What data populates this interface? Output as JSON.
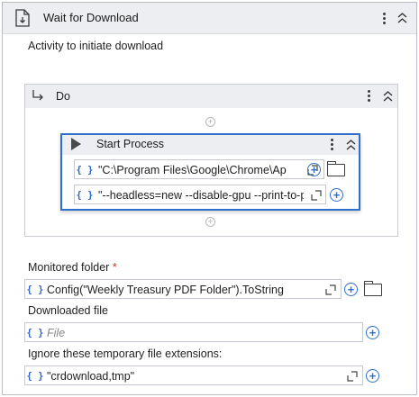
{
  "header": {
    "title": "Wait for Download"
  },
  "description": "Activity to initiate download",
  "do_block": {
    "title": "Do",
    "start_process": {
      "title": "Start Process",
      "file_name": "\"C:\\Program Files\\Google\\Chrome\\Ap",
      "arguments": "\"--headless=new --disable-gpu --print-to-p"
    }
  },
  "monitored_folder": {
    "label": "Monitored folder",
    "required_mark": "*",
    "value": "Config(\"Weekly Treasury PDF Folder\").ToString"
  },
  "downloaded_file": {
    "label": "Downloaded file",
    "placeholder": "File"
  },
  "ignore_extensions": {
    "label": "Ignore these temporary file extensions:",
    "value": "\"crdownload,tmp\""
  },
  "glyphs": {
    "brace": "{ }",
    "plus": "+",
    "gray_plus": "+"
  },
  "colors": {
    "accent": "#2f6fcc",
    "header_bg": "#eceef1",
    "focus_border": "#2f6fcc"
  },
  "icons": [
    "download-file-icon",
    "kebab-menu-icon",
    "collapse-icon",
    "do-arrow-icon",
    "play-icon",
    "expand-icon",
    "add-icon",
    "folder-icon",
    "expression-braces-icon"
  ]
}
